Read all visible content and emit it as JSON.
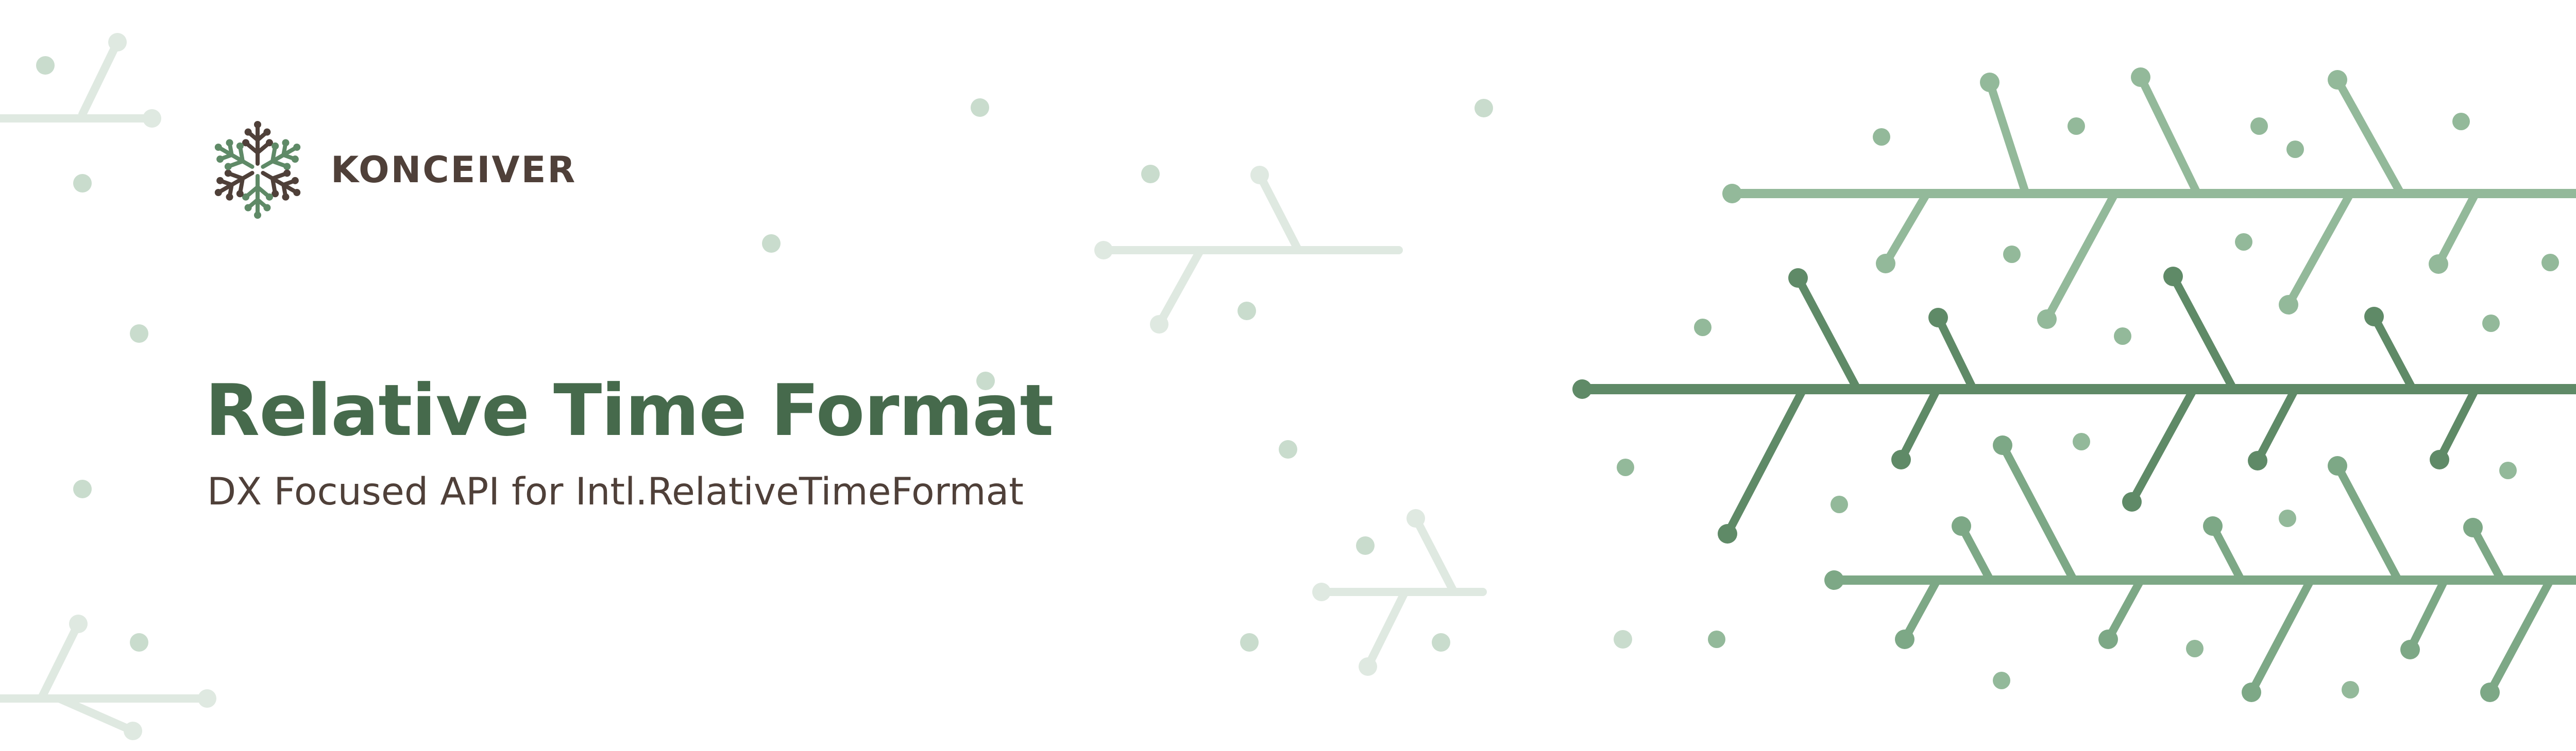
{
  "brand": {
    "name": "KONCEIVER",
    "logo_icon": "snowflake-branch-icon"
  },
  "hero": {
    "title": "Relative Time Format",
    "subtitle": "DX Focused API for Intl.RelativeTimeFormat"
  },
  "colors": {
    "title": "#466a4c",
    "subtitle": "#4f4039",
    "brand_text": "#4f4039",
    "branch_dark": "#5f8a67",
    "branch_mid": "#7da886",
    "branch_light": "#93b99a",
    "branch_faint": "#dfe9e1",
    "dot_faint": "#c9dccd",
    "logo_dark": "#4f4039",
    "logo_green": "#5f8a67",
    "background": "#ffffff"
  }
}
